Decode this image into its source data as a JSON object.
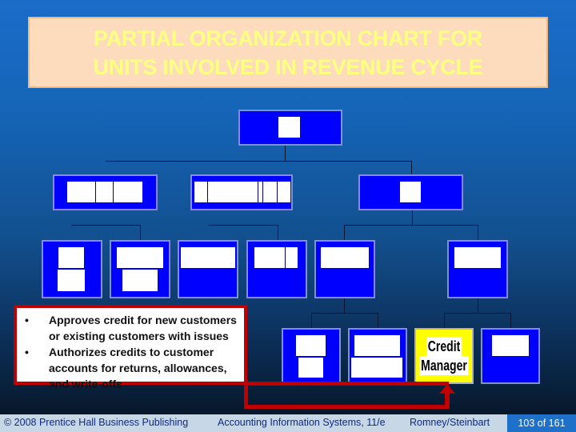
{
  "slide": {
    "title_lines": [
      "PARTIAL ORGANIZATION CHART FOR",
      "UNITS INVOLVED IN REVENUE CYCLE"
    ],
    "colors": {
      "background_top": "#1a6cc8",
      "background_bottom": "#06121f",
      "title_box": "#fddcbe",
      "title_text": "#ffff80",
      "node_fill": "#0000ff",
      "highlight_fill": "#ffff00",
      "callout_border": "#c00000"
    }
  },
  "org_chart": {
    "levels": [
      {
        "level": 1,
        "nodes": [
          {
            "label": "",
            "obscured": true
          }
        ]
      },
      {
        "level": 2,
        "nodes": [
          {
            "label": "",
            "obscured": true
          },
          {
            "label": "",
            "obscured": true
          },
          {
            "label": "",
            "obscured": true
          }
        ]
      },
      {
        "level": 3,
        "nodes": [
          {
            "label": "",
            "obscured": true
          },
          {
            "label": "",
            "obscured": true
          },
          {
            "label": "",
            "obscured": true
          },
          {
            "label": "",
            "obscured": true
          },
          {
            "label": "",
            "obscured": true
          },
          {
            "label": "",
            "obscured": true
          }
        ]
      },
      {
        "level": 4,
        "nodes": [
          {
            "label": "",
            "obscured": true
          },
          {
            "label": "",
            "obscured": true
          },
          {
            "label_lines": [
              "Credit",
              "Manager"
            ],
            "highlighted": true
          },
          {
            "label": "",
            "obscured": true
          }
        ]
      }
    ],
    "highlighted_node": {
      "line1": "Credit",
      "line2": "Manager"
    }
  },
  "callout": {
    "items": [
      {
        "bullet": "•",
        "text": "Approves credit for new customers or existing customers with issues"
      },
      {
        "bullet": "•",
        "text": "Authorizes credits to customer accounts for returns, allowances, and write-offs"
      }
    ],
    "points_to": "Credit Manager"
  },
  "footer": {
    "copyright": "© 2008 Prentice Hall Business Publishing",
    "book": "Accounting Information Systems, 11/e",
    "authors": "Romney/Steinbart",
    "page": "103 of 161"
  }
}
